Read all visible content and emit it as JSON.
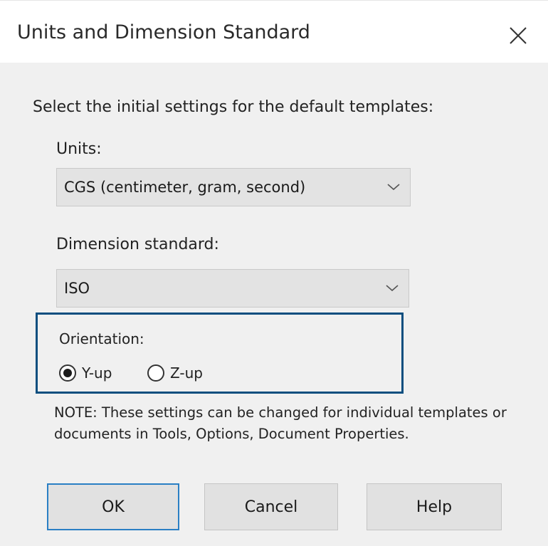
{
  "window": {
    "title": "Units and Dimension Standard",
    "close_icon": "close-icon"
  },
  "content": {
    "instruction": "Select the initial settings for the default templates:",
    "units": {
      "label": "Units:",
      "selected": "CGS (centimeter, gram, second)"
    },
    "dimension_standard": {
      "label": "Dimension standard:",
      "selected": "ISO"
    },
    "orientation": {
      "label": "Orientation:",
      "options": [
        {
          "label": "Y-up",
          "selected": true
        },
        {
          "label": "Z-up",
          "selected": false
        }
      ],
      "highlight_color": "#0b4e7f"
    },
    "note": "NOTE: These settings can be changed for individual templates or documents in Tools, Options, Document Properties."
  },
  "buttons": {
    "ok": "OK",
    "cancel": "Cancel",
    "help": "Help"
  },
  "colors": {
    "dialog_background": "#f0f0f0",
    "default_button_border": "#2a7fc4"
  }
}
